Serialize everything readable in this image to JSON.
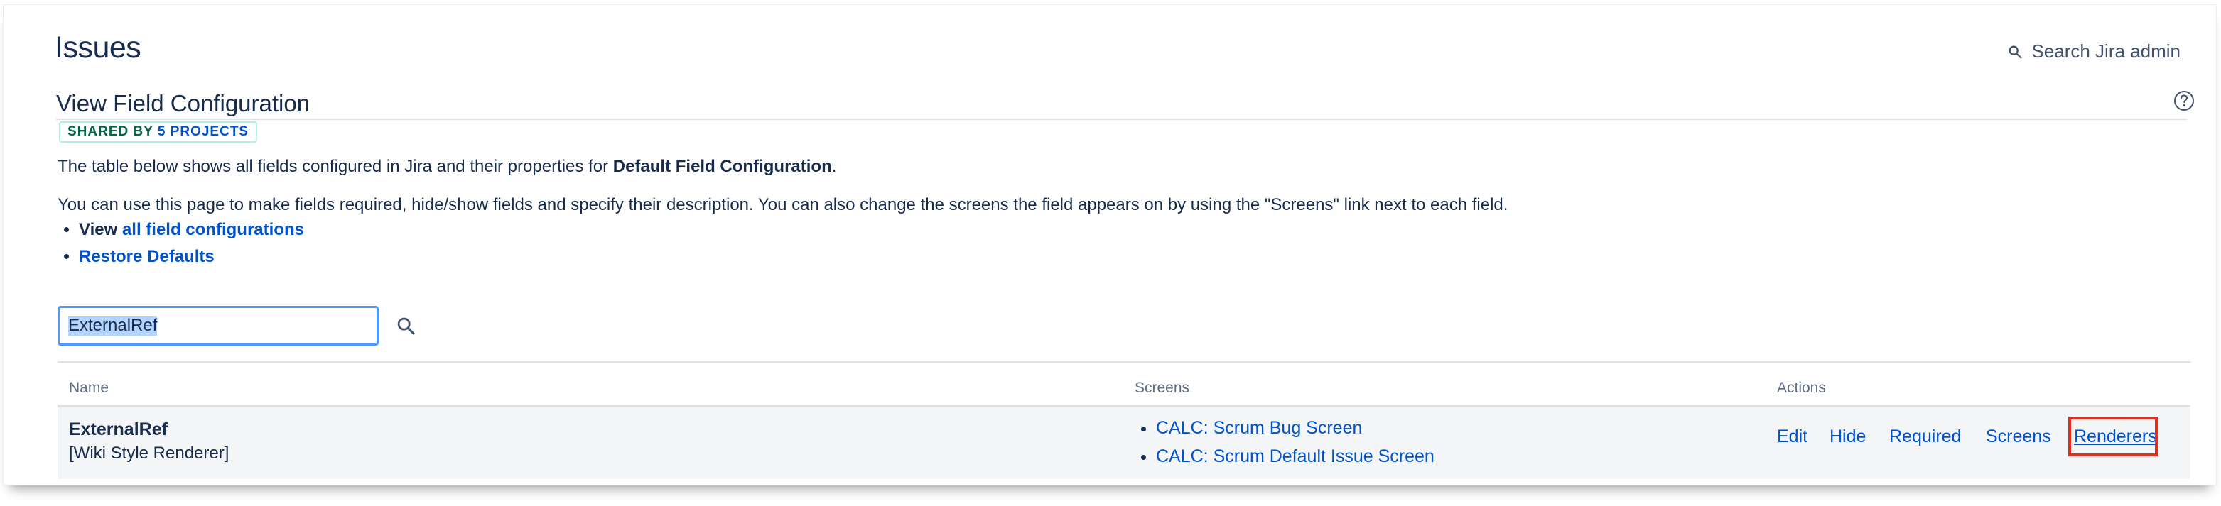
{
  "page": {
    "title": "Issues",
    "search_admin_label": "Search Jira admin"
  },
  "config": {
    "title": "View Field Configuration",
    "badge_prefix": "SHARED BY",
    "badge_count": "5 PROJECTS",
    "desc1_prefix": "The table below shows all fields configured in Jira and their properties for ",
    "desc1_config_name": "Default Field Configuration",
    "desc1_suffix": ".",
    "desc2": "You can use this page to make fields required, hide/show fields and specify their description. You can also change the screens the field appears on by using the \"Screens\" link next to each field.",
    "link1_prefix": "View ",
    "link1_label": "all field configurations",
    "link2_label": "Restore Defaults"
  },
  "filter": {
    "value": "ExternalRef"
  },
  "table": {
    "headers": {
      "name": "Name",
      "screens": "Screens",
      "actions": "Actions"
    },
    "rows": [
      {
        "name": "ExternalRef",
        "renderer": "[Wiki Style Renderer]",
        "screens": [
          "CALC: Scrum Bug Screen",
          "CALC: Scrum Default Issue Screen"
        ],
        "actions": {
          "edit": "Edit",
          "hide": "Hide",
          "required": "Required",
          "screens": "Screens",
          "renderers": "Renderers"
        }
      }
    ]
  },
  "colors": {
    "link": "#0052cc",
    "text": "#172b4d",
    "highlight": "#e0301e",
    "badge_green": "#006644"
  },
  "icons": {
    "search": "search-icon",
    "help": "help-icon"
  }
}
